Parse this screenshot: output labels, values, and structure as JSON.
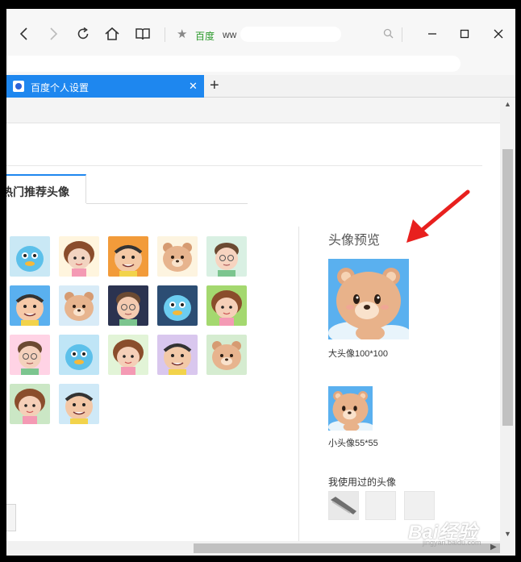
{
  "toolbar": {
    "site_label": "百度",
    "url_text": "ww"
  },
  "tab": {
    "title": "百度个人设置"
  },
  "section": {
    "hot_tab_label": "热门推荐头像"
  },
  "preview": {
    "title": "头像预览",
    "big_caption": "大头像100*100",
    "small_caption": "小头像55*55",
    "used_title": "我使用过的头像"
  },
  "watermark": {
    "brand": "Bai经验",
    "url": "jingyan.baidu.com"
  },
  "colors": {
    "accent": "#1e87ef",
    "arrow": "#e8201e",
    "site_green": "#2c9a2c"
  },
  "avatars": [
    {
      "bg": "#c9e8f5",
      "face": "#5cc0ea",
      "kind": "bird"
    },
    {
      "bg": "#fff5de",
      "face": "#f2d3c0",
      "kind": "girl"
    },
    {
      "bg": "#f29b3a",
      "face": "#f4c9a5",
      "kind": "man"
    },
    {
      "bg": "#fdf4e0",
      "face": "#e7b48e",
      "kind": "bear"
    },
    {
      "bg": "#d9f0e3",
      "face": "#f7d4c0",
      "kind": "boy"
    },
    {
      "bg": "#5ab0ef",
      "face": "#f6c9a8",
      "kind": "man"
    },
    {
      "bg": "#d8ebf7",
      "face": "#e7b48e",
      "kind": "bear"
    },
    {
      "bg": "#2b3350",
      "face": "#f4cbb0",
      "kind": "boy"
    },
    {
      "bg": "#2c4d73",
      "face": "#6ccdf0",
      "kind": "bird"
    },
    {
      "bg": "#a4d86f",
      "face": "#f5cfb8",
      "kind": "girl"
    },
    {
      "bg": "#ffd3e5",
      "face": "#f4d1bc",
      "kind": "boy"
    },
    {
      "bg": "#bfe5f6",
      "face": "#5cc0ea",
      "kind": "bird"
    },
    {
      "bg": "#e2f4d7",
      "face": "#f5cfb8",
      "kind": "girl"
    },
    {
      "bg": "#d9c7ee",
      "face": "#f2c9a8",
      "kind": "man"
    },
    {
      "bg": "#d5ecd0",
      "face": "#e7b48e",
      "kind": "bear"
    },
    {
      "bg": "#cbe7c5",
      "face": "#f5cfb8",
      "kind": "girl"
    },
    {
      "bg": "#cfe9f7",
      "face": "#f3c7a6",
      "kind": "man"
    }
  ]
}
